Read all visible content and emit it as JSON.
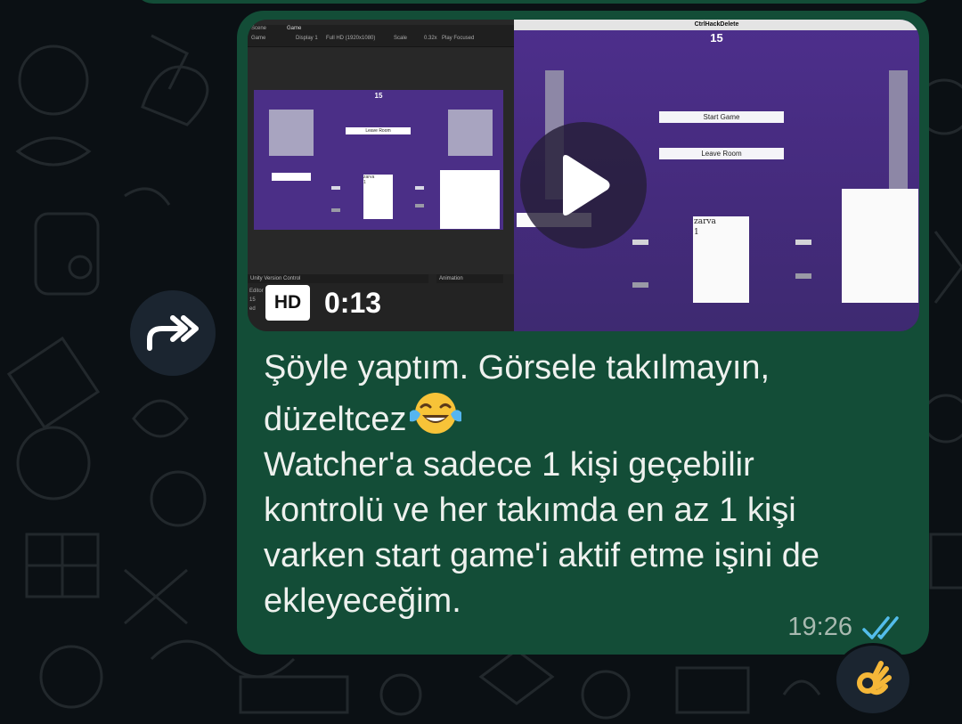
{
  "message": {
    "line1": "Şöyle yaptım. Görsele takılmayın,",
    "line2": "düzeltcez",
    "line2_emoji": "face-with-tears-of-joy",
    "line3": "Watcher'a sadece 1 kişi geçebilir",
    "line4": "kontrolü ve her takımda en az 1 kişi",
    "line5": "varken start game'i aktif etme işini de",
    "line6": "ekleyeceğim.",
    "time": "19:26",
    "status_icon": "double-check-read-icon",
    "reaction": "ok-hand-emoji"
  },
  "video": {
    "badge": "HD",
    "duration": "0:13",
    "play_icon": "play-icon"
  },
  "editor": {
    "tab_scene": "Scene",
    "tab_game": "Game",
    "display_mode": "Game",
    "display": "Display 1",
    "resolution": "Full HD (1920x1080)",
    "scale_label": "Scale",
    "scale_value": "0.32x",
    "play_mode": "Play Focused",
    "preview_score": "15",
    "preview_leave_label": "Leave Room",
    "preview_player": "zarva",
    "preview_player_value": "1",
    "panel_version_control": "Unity Version Control",
    "panel_animation": "Animation",
    "side_editor": "Editor",
    "side_2": "15",
    "side_3": "ed"
  },
  "game_window": {
    "title": "CtrlHackDelete",
    "score": "15",
    "start_button": "Start Game",
    "leave_button": "Leave Room",
    "player_name": "zarva",
    "player_value": "1"
  },
  "colors": {
    "background": "#0b1014",
    "bubble": "#134d37",
    "text": "#eef1ee",
    "meta_text": "#a8b9b0",
    "read_check": "#53bdeb",
    "game_bg": "#4b2f87"
  }
}
